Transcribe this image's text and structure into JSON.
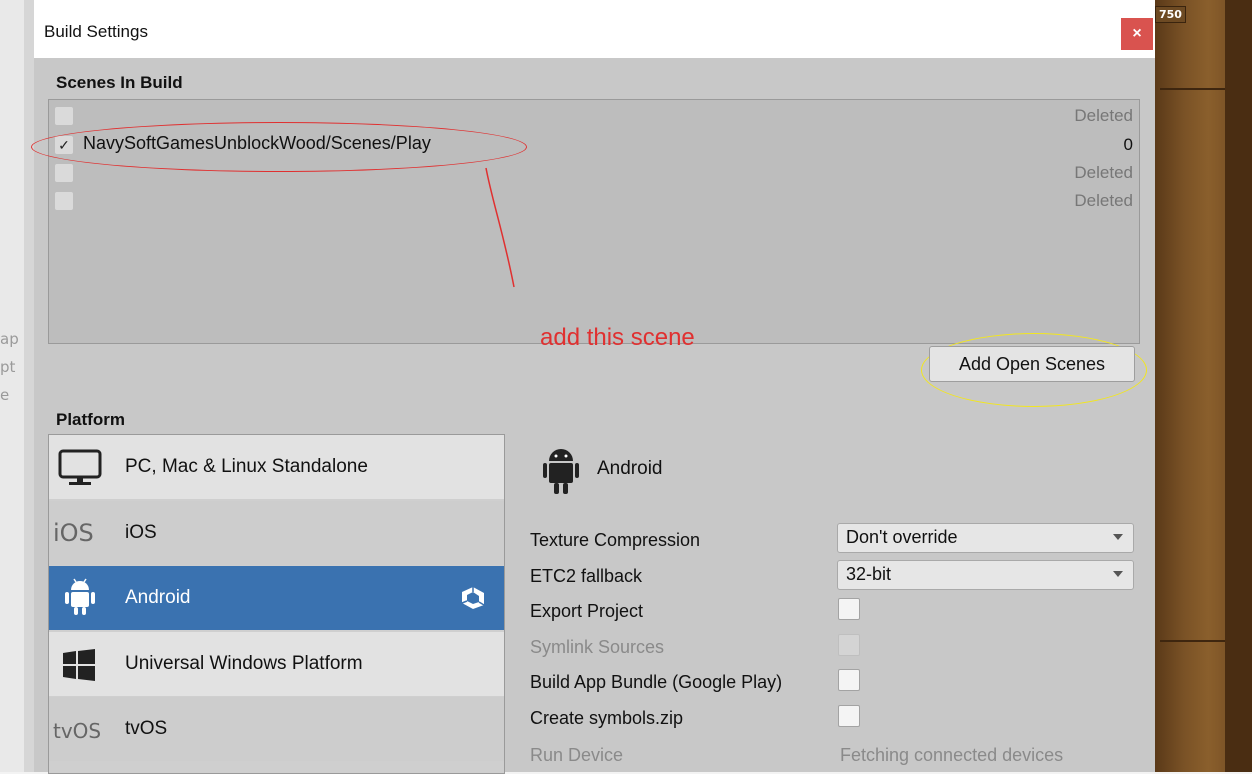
{
  "window": {
    "title": "Build Settings",
    "close_glyph": "×"
  },
  "background": {
    "left_fragments": [
      "ap",
      "pt",
      "e"
    ],
    "score": "750"
  },
  "scenes": {
    "label": "Scenes In Build",
    "rows": [
      {
        "checked": false,
        "path": "",
        "status": "Deleted"
      },
      {
        "checked": true,
        "path": "NavySoftGamesUnblockWood/Scenes/Play",
        "status": "0"
      },
      {
        "checked": false,
        "path": "",
        "status": "Deleted"
      },
      {
        "checked": false,
        "path": "",
        "status": "Deleted"
      }
    ],
    "add_open_scenes_label": "Add Open Scenes"
  },
  "annotations": {
    "text": "add this scene",
    "color_red": "#e03030",
    "color_yellow": "#f2e620"
  },
  "platform": {
    "label": "Platform",
    "items": [
      {
        "label": "PC, Mac & Linux Standalone",
        "icon": "monitor-icon",
        "selected": false
      },
      {
        "label": "iOS",
        "icon": "ios-icon",
        "icon_text": "iOS",
        "selected": false
      },
      {
        "label": "Android",
        "icon": "android-icon",
        "selected": true,
        "badge_icon": "unity-icon"
      },
      {
        "label": "Universal Windows Platform",
        "icon": "windows-icon",
        "selected": false
      },
      {
        "label": "tvOS",
        "icon": "tvos-icon",
        "icon_text": "tvOS",
        "selected": false
      }
    ]
  },
  "settings": {
    "title": "Android",
    "title_icon": "android-icon",
    "texture_compression": {
      "label": "Texture Compression",
      "value": "Don't override"
    },
    "etc2_fallback": {
      "label": "ETC2 fallback",
      "value": "32-bit"
    },
    "export_project": {
      "label": "Export Project",
      "checked": false
    },
    "symlink_sources": {
      "label": "Symlink Sources",
      "checked": false,
      "disabled": true
    },
    "build_app_bundle": {
      "label": "Build App Bundle (Google Play)",
      "checked": false
    },
    "create_symbols": {
      "label": "Create symbols.zip",
      "checked": false
    },
    "run_device": {
      "label": "Run Device",
      "value": "Fetching connected devices",
      "disabled": true
    }
  },
  "colors": {
    "selected": "#3a72b0",
    "close": "#d9534f"
  }
}
